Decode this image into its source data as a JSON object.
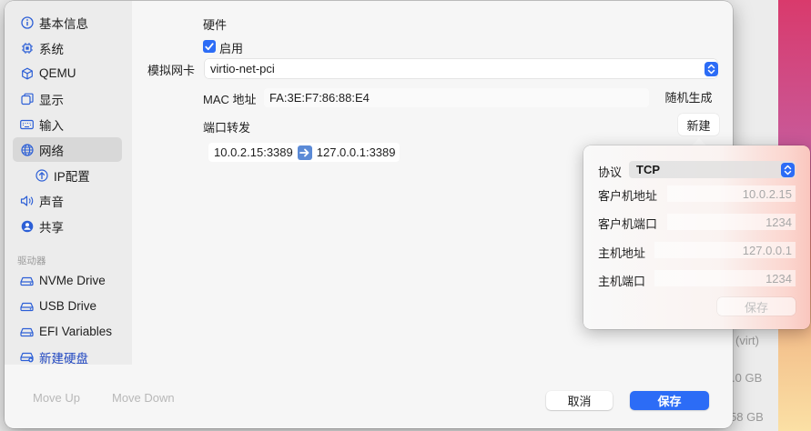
{
  "background_fragments": {
    "virt": "(virt)",
    "gb1": ".0 GB",
    "gb2": "58 GB"
  },
  "sidebar": {
    "items": [
      {
        "label": "基本信息",
        "icon": "info-icon"
      },
      {
        "label": "系统",
        "icon": "cpu-icon"
      },
      {
        "label": "QEMU",
        "icon": "cube-icon"
      },
      {
        "label": "显示",
        "icon": "display-icon"
      },
      {
        "label": "输入",
        "icon": "keyboard-icon"
      },
      {
        "label": "网络",
        "icon": "globe-icon",
        "selected": true
      },
      {
        "label": "IP配置",
        "icon": "arrow-circle-icon"
      },
      {
        "label": "声音",
        "icon": "speaker-icon"
      },
      {
        "label": "共享",
        "icon": "person-icon"
      }
    ],
    "section_drives": "驱动器",
    "drives": [
      {
        "label": "NVMe Drive",
        "icon": "drive-icon"
      },
      {
        "label": "USB Drive",
        "icon": "drive-icon"
      },
      {
        "label": "EFI Variables",
        "icon": "drive-icon"
      },
      {
        "label": "新建硬盘",
        "icon": "add-drive-icon"
      }
    ]
  },
  "network": {
    "hardware_heading": "硬件",
    "enable_label": "启用",
    "enable_checked": true,
    "nic_label": "模拟网卡",
    "nic_value": "virtio-net-pci",
    "mac_label": "MAC 地址",
    "mac_value": "FA:3E:F7:86:88:E4",
    "random_button": "随机生成",
    "port_forward_label": "端口转发",
    "new_button": "新建",
    "forward_rule": {
      "guest": "10.0.2.15:3389",
      "host": "127.0.0.1:3389"
    }
  },
  "popover": {
    "protocol_label": "协议",
    "protocol_value": "TCP",
    "guest_address_label": "客户机地址",
    "guest_address_placeholder": "10.0.2.15",
    "guest_port_label": "客户机端口",
    "guest_port_placeholder": "1234",
    "host_address_label": "主机地址",
    "host_address_placeholder": "127.0.0.1",
    "host_port_label": "主机端口",
    "host_port_placeholder": "1234",
    "save_button": "保存"
  },
  "footer": {
    "move_up": "Move Up",
    "move_down": "Move Down",
    "cancel": "取消",
    "save": "保存"
  },
  "colors": {
    "accent": "#2c6cf6",
    "sidebar_icon": "#2c5fd6",
    "selected_row": "#d8d8d8",
    "new_drive_text": "#1f46c0"
  }
}
